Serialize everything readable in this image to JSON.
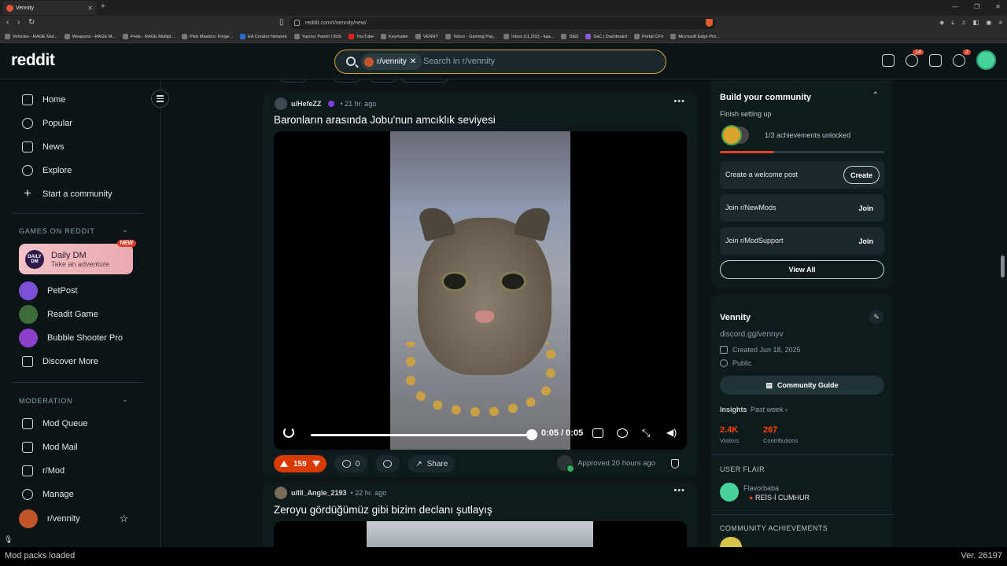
{
  "browser": {
    "tab_title": "Vennity",
    "url": "reddit.com/r/vennity/new/",
    "bookmarks": [
      "Vehicles - RAGE Mul...",
      "Weapons - RAGE M...",
      "Peds - RAGE Multipl...",
      "Pleb Masters: Forge...",
      "EA Creator Network",
      "Yayıncı Paneli | Kick",
      "YouTube",
      "Keymailer",
      "VENNY",
      "Tebex - Gaming Pay...",
      "Inbox (11,202) - kaa...",
      "D&D",
      "SaC | Dashboard",
      "Portal CFX",
      "Microsoft Edge Pro..."
    ]
  },
  "header": {
    "logo": "reddit",
    "search_chip": "r/vennity",
    "search_placeholder": "Search in r/vennity",
    "chat_badge": "14",
    "notif_badge": "2"
  },
  "sidebar": {
    "nav": [
      "Home",
      "Popular",
      "News",
      "Explore",
      "Start a community"
    ],
    "games_heading": "GAMES ON REDDIT",
    "daily_dm_title": "Daily DM",
    "daily_dm_sub": "Take an adventure",
    "daily_dm_logo": "DAILY DM",
    "new_badge": "NEW",
    "games": [
      "PetPost",
      "Readit Game",
      "Bubble Shooter Pro",
      "Discover More"
    ],
    "mod_heading": "MODERATION",
    "mod_items": [
      "Mod Queue",
      "Mod Mail",
      "r/Mod",
      "Manage",
      "r/vennity"
    ]
  },
  "posts": [
    {
      "author": "u/HefeZZ",
      "time": "• 21 hr. ago",
      "title": "Baronların arasında Jobu'nun amcıklık seviyesi",
      "video_time": "0:05 / 0:05",
      "video_progress": 1.0,
      "votes": "159",
      "comments": "0",
      "share": "Share",
      "approved": "Approved 20 hours ago"
    },
    {
      "author": "u/Ill_Angle_2193",
      "time": "• 22 hr. ago",
      "title": "Zeroyu gördüğümüz gibi bizim declanı şutlayış"
    }
  ],
  "right": {
    "build_title": "Build your community",
    "finish_setup": "Finish setting up",
    "achievements": "1/3 achievements unlocked",
    "achievement_progress": 0.33,
    "tasks": [
      {
        "label": "Create a welcome post",
        "action": "Create"
      },
      {
        "label": "Join r/NewMods",
        "action": "Join"
      },
      {
        "label": "Join r/ModSupport",
        "action": "Join"
      }
    ],
    "view_all": "View All",
    "community_name": "Vennity",
    "community_link": "discord.gg/vennyv",
    "created": "Created Jun 18, 2025",
    "visibility": "Public",
    "guide": "Community Guide",
    "insights": "Insights",
    "insights_range": "Past week ›",
    "visitors_value": "2.4K",
    "visitors_label": "Visitors",
    "contrib_value": "267",
    "contrib_label": "Contributions",
    "user_flair_heading": "USER FLAIR",
    "flair_user": "Flavorbaba",
    "flair_text": "REİS-İ CUMHUR",
    "achievements_heading": "COMMUNITY ACHIEVEMENTS"
  },
  "status": {
    "left": "Mod packs loaded",
    "right": "Ver. 26197"
  }
}
